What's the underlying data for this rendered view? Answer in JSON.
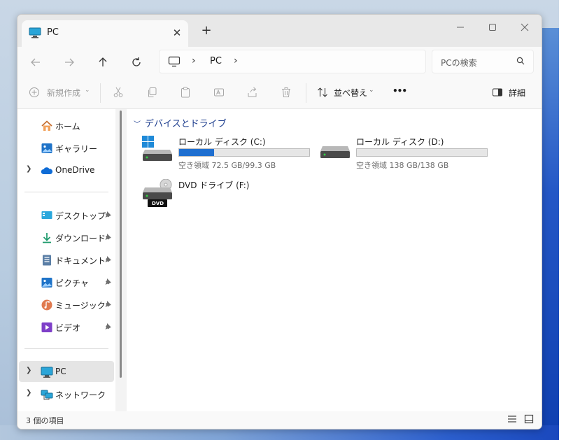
{
  "window": {
    "tab_title": "PC",
    "new_tab": "+"
  },
  "nav": {
    "breadcrumb": "PC",
    "search_placeholder": "PCの検索"
  },
  "toolbar": {
    "new_label": "新規作成",
    "sort_label": "並べ替え",
    "more_label": "•••",
    "details_label": "詳細"
  },
  "sidebar": {
    "items": [
      {
        "label": "ホーム",
        "icon": "home-icon"
      },
      {
        "label": "ギャラリー",
        "icon": "gallery-icon"
      },
      {
        "label": "OneDrive",
        "icon": "onedrive-cloud-icon"
      },
      {
        "label": "デスクトップ",
        "icon": "desktop-folder-icon"
      },
      {
        "label": "ダウンロード",
        "icon": "download-icon"
      },
      {
        "label": "ドキュメント",
        "icon": "documents-icon"
      },
      {
        "label": "ピクチャ",
        "icon": "pictures-icon"
      },
      {
        "label": "ミュージック",
        "icon": "music-icon"
      },
      {
        "label": "ビデオ",
        "icon": "videos-icon"
      },
      {
        "label": "PC",
        "icon": "pc-monitor-icon"
      },
      {
        "label": "ネットワーク",
        "icon": "network-icon"
      }
    ]
  },
  "content": {
    "group_title": "デバイスとドライブ",
    "drives": [
      {
        "name": "ローカル ディスク (C:)",
        "size_text": "空き領域 72.5 GB/99.3 GB",
        "used_fraction": 0.27,
        "bar_color": "#1f6fd0"
      },
      {
        "name": "ローカル ディスク (D:)",
        "size_text": "空き領域 138 GB/138 GB",
        "used_fraction": 0.0,
        "bar_color": "#1f6fd0"
      },
      {
        "name": "DVD ドライブ (F:)",
        "size_text": "",
        "used_fraction": null
      }
    ],
    "dvd_badge": "DVD"
  },
  "status": {
    "item_count": "3 個の項目"
  },
  "colors": {
    "accent": "#1f6fd0",
    "group_header": "#1f3f8f",
    "selected_bg": "#e5e5e5"
  }
}
